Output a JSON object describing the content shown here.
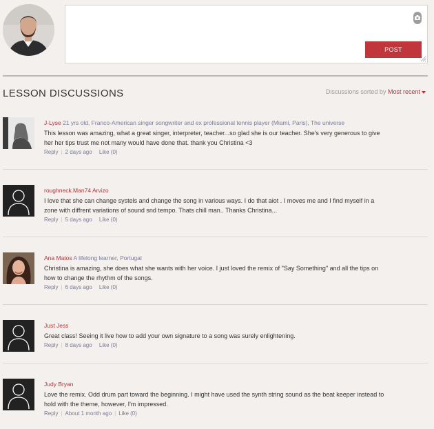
{
  "composer": {
    "post_label": "POST",
    "placeholder": ""
  },
  "header": {
    "title": "LESSON DISCUSSIONS",
    "sort_prefix": "Discussions sorted by",
    "sort_value": "Most recent"
  },
  "comments": [
    {
      "author": "J-Lyse",
      "tagline": "21 yrs old, Franco-American singer songwriter and ex professional tennis player (Miami, Paris), The universe",
      "text": "This lesson was amazing, what a great singer, interpreter, teacher...so glad she is our teacher. She's very generous to give her her tips trust me not many would have done that. thank you Christina <3",
      "reply": "Reply",
      "time": "2 days ago",
      "like": "Like (0)"
    },
    {
      "author": "roughneck.Man74 Arvizo",
      "tagline": "",
      "text": "I love that she can change systels and change the song in various ways. I do that aiot . I moves me and I find myself in a zone with diffrent variations of sound snd tempo. Thats chill man.. Thanks Christina...",
      "reply": "Reply",
      "time": "5 days ago",
      "like": "Like (0)"
    },
    {
      "author": "Ana Matos",
      "tagline": "A lifelong learner, Portugal",
      "text": "Christina is amazing, she does what she wants with her voice. I just loved the remix of \"Say Something\" and all the tips on how to change the rhythm of the songs.",
      "reply": "Reply",
      "time": "6 days ago",
      "like": "Like (0)"
    },
    {
      "author": "Just Jess",
      "tagline": "",
      "text": "Great class! Seeing it live how to add your own signature to a song was surely enlightening.",
      "reply": "Reply",
      "time": "8 days ago",
      "like": "Like (0)"
    },
    {
      "author": "Judy Bryan",
      "tagline": "",
      "text": "Love the remix. Odd drum part toward the beginning. I might have used the synth string sound as the beat keeper instead to hold with the theme, however, I'm impressed.",
      "reply": "Reply",
      "time": "About 1 month ago",
      "like": "Like (0)"
    }
  ],
  "colors": {
    "accent": "#c0363b",
    "link": "#7a7a96",
    "background": "#f3f0ee"
  }
}
